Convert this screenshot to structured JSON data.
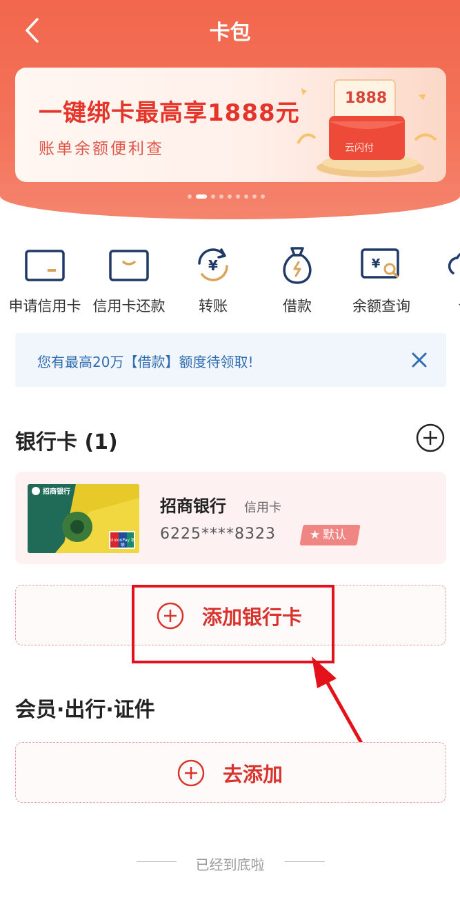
{
  "nav": {
    "title": "卡包"
  },
  "banner": {
    "headline": "一键绑卡最高享1888元",
    "subtitle": "账单余额便利查",
    "art_amount": "1888",
    "art_brand": "云闪付",
    "dots_total": 9,
    "dots_active_index": 1
  },
  "quick_actions": [
    {
      "label": "申请信用卡",
      "icon": "credit-card-icon"
    },
    {
      "label": "信用卡还款",
      "icon": "card-repay-icon"
    },
    {
      "label": "转账",
      "icon": "transfer-icon"
    },
    {
      "label": "借款",
      "icon": "loan-bag-icon"
    },
    {
      "label": "余额查询",
      "icon": "balance-query-icon"
    },
    {
      "label": "云",
      "icon": "cloud-icon"
    }
  ],
  "notice": {
    "text": "您有最高20万【借款】额度待领取!"
  },
  "bank_section": {
    "title": "银行卡 (1)",
    "cards": [
      {
        "bank_name": "招商银行",
        "card_type": "信用卡",
        "card_number": "6225****8323",
        "badge": "默认",
        "thumb_bank_name": "招商银行",
        "thumb_network": "UnionPay 银联"
      }
    ],
    "add_label": "添加银行卡"
  },
  "member_section": {
    "title": "会员·出行·证件",
    "add_label": "去添加"
  },
  "footer": {
    "text": "已经到底啦"
  },
  "colors": {
    "header": "#f2674d",
    "accent_red": "#d8332d",
    "notice_text": "#2f6cb0",
    "highlight": "#e3121a"
  }
}
